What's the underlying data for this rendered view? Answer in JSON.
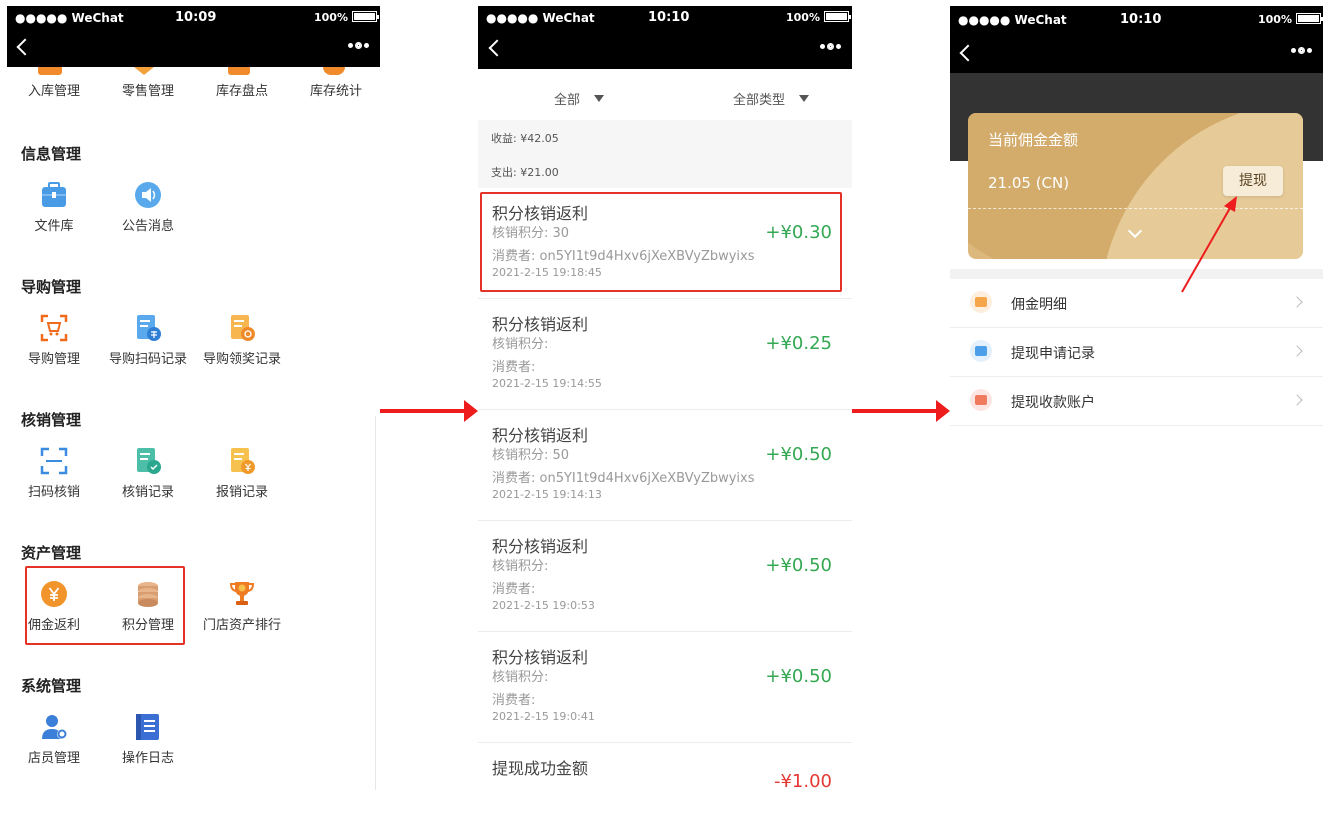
{
  "statusbar_1": {
    "carrier": "●●●●● WeChat",
    "time": "10:09",
    "battery": "100%"
  },
  "statusbar_2": {
    "carrier": "●●●●● WeChat",
    "time": "10:10",
    "battery": "100%"
  },
  "statusbar_3": {
    "carrier": "●●●●● WeChat",
    "time": "10:10",
    "battery": "100%"
  },
  "panel1": {
    "top_row": [
      "入库管理",
      "零售管理",
      "库存盘点",
      "库存统计"
    ],
    "sections": [
      {
        "title": "信息管理",
        "items": [
          "文件库",
          "公告消息"
        ]
      },
      {
        "title": "导购管理",
        "items": [
          "导购管理",
          "导购扫码记录",
          "导购领奖记录"
        ]
      },
      {
        "title": "核销管理",
        "items": [
          "扫码核销",
          "核销记录",
          "报销记录"
        ]
      },
      {
        "title": "资产管理",
        "items": [
          "佣金返利",
          "积分管理",
          "门店资产排行"
        ]
      },
      {
        "title": "系统管理",
        "items": [
          "店员管理",
          "操作日志"
        ]
      }
    ]
  },
  "panel2": {
    "filter_all": "全部",
    "filter_type": "全部类型",
    "income": "收益: ¥42.05",
    "expense": "支出: ¥21.00",
    "records": [
      {
        "title": "积分核销返利",
        "points": "核销积分: 30",
        "consumer": "消费者: on5YI1t9d4Hxv6jXeXBVyZbwyixs",
        "date": "2021-2-15 19:18:45",
        "amount": "+¥0.30"
      },
      {
        "title": "积分核销返利",
        "points": "核销积分:",
        "consumer": "消费者:",
        "date": "2021-2-15 19:14:55",
        "amount": "+¥0.25"
      },
      {
        "title": "积分核销返利",
        "points": "核销积分: 50",
        "consumer": "消费者: on5YI1t9d4Hxv6jXeXBVyZbwyixs",
        "date": "2021-2-15 19:14:13",
        "amount": "+¥0.50"
      },
      {
        "title": "积分核销返利",
        "points": "核销积分:",
        "consumer": "消费者:",
        "date": "2021-2-15 19:0:53",
        "amount": "+¥0.50"
      },
      {
        "title": "积分核销返利",
        "points": "核销积分:",
        "consumer": "消费者:",
        "date": "2021-2-15 19:0:41",
        "amount": "+¥0.50"
      },
      {
        "title": "提现成功金额",
        "points": "",
        "consumer": "",
        "date": "",
        "amount": "-¥1.00"
      }
    ]
  },
  "panel3": {
    "card_label": "当前佣金金额",
    "card_value": "21.05 (CN)",
    "withdraw_button": "提现",
    "menu": [
      "佣金明细",
      "提现申请记录",
      "提现收款账户"
    ]
  },
  "colors": {
    "income_green": "#34a853",
    "expense_red": "#e53935",
    "annotation_red": "#ee1c1c",
    "card_gold": "#dcb87c"
  }
}
